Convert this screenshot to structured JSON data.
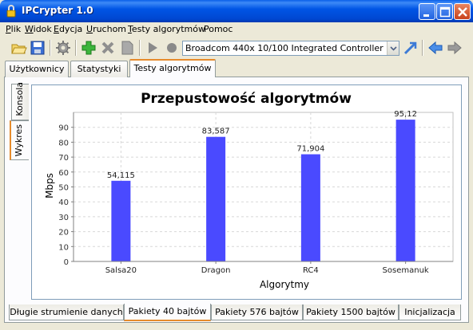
{
  "window": {
    "title": "IPCrypter 1.0"
  },
  "menu": [
    {
      "label": "Plik",
      "u": "P",
      "rest": "lik"
    },
    {
      "label": "Widok",
      "u": "W",
      "rest": "idok"
    },
    {
      "label": "Edycja",
      "u": "E",
      "rest": "dycja"
    },
    {
      "label": "Uruchom",
      "u": "U",
      "rest": "ruchom"
    },
    {
      "label": "Testy algorytmów",
      "u": "T",
      "rest": "esty algorytmów"
    },
    {
      "label": "Pomoc",
      "u": "",
      "rest": "Pomoc"
    }
  ],
  "toolbar": {
    "interface_selected": "Broadcom 440x 10/100 Integrated Controller",
    "icons": [
      "open-folder-icon",
      "save-icon",
      "settings-icon",
      "add-icon",
      "delete-icon",
      "document-icon",
      "play-icon",
      "record-icon",
      "connect-icon",
      "back-icon",
      "forward-icon"
    ]
  },
  "tabs": [
    "Użytkownicy",
    "Statystyki",
    "Testy algorytmów"
  ],
  "active_tab": "Testy algorytmów",
  "side_tabs": [
    "Wykres",
    "Konsola"
  ],
  "active_side_tab": "Wykres",
  "bottom_tabs": [
    "Długie strumienie danych",
    "Pakiety 40 bajtów",
    "Pakiety 576 bajtów",
    "Pakiety 1500 bajtów",
    "Inicjalizacja"
  ],
  "active_bottom_tab": "Pakiety 40 bajtów",
  "chart_data": {
    "type": "bar",
    "title": "Przepustowość algorytmów",
    "xlabel": "Algorytmy",
    "ylabel": "Mbps",
    "categories": [
      "Salsa20",
      "Dragon",
      "RC4",
      "Sosemanuk"
    ],
    "values": [
      54.115,
      83.587,
      71.904,
      95.12
    ],
    "value_labels": [
      "54,115",
      "83,587",
      "71,904",
      "95,12"
    ],
    "yticks": [
      0,
      10,
      20,
      30,
      40,
      50,
      60,
      70,
      80,
      90
    ],
    "ylim": [
      0,
      100
    ],
    "grid": true,
    "bar_color": "#4a4aff"
  }
}
